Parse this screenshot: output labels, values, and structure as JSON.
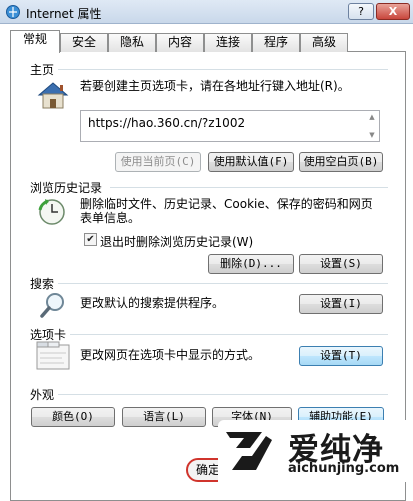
{
  "window": {
    "title": "Internet 属性",
    "help_label": "?",
    "close_label": "X"
  },
  "tabs": [
    {
      "label": "常规",
      "active": true
    },
    {
      "label": "安全"
    },
    {
      "label": "隐私"
    },
    {
      "label": "内容"
    },
    {
      "label": "连接"
    },
    {
      "label": "程序"
    },
    {
      "label": "高级"
    }
  ],
  "homepage": {
    "section_title": "主页",
    "description": "若要创建主页选项卡，请在各地址行键入地址(R)。",
    "url": "https://hao.360.cn/?z1002",
    "use_current_label": "使用当前页(C)",
    "use_default_label": "使用默认值(F)",
    "use_blank_label": "使用空白页(B)"
  },
  "history": {
    "section_title": "浏览历史记录",
    "description_line1": "删除临时文件、历史记录、Cookie、保存的密码和网页",
    "description_line2": "表单信息。",
    "checkbox_label": "退出时删除浏览历史记录(W)",
    "checkbox_checked": true,
    "delete_label": "删除(D)...",
    "settings_label": "设置(S)"
  },
  "search": {
    "section_title": "搜索",
    "description": "更改默认的搜索提供程序。",
    "settings_label": "设置(I)"
  },
  "tabs_section": {
    "section_title": "选项卡",
    "description": "更改网页在选项卡中显示的方式。",
    "settings_label": "设置(T)"
  },
  "appearance": {
    "section_title": "外观",
    "colors_label": "颜色(O)",
    "languages_label": "语言(L)",
    "fonts_label": "字体(N)",
    "accessibility_label": "辅助功能(E)"
  },
  "footer": {
    "ok_label": "确定"
  },
  "watermark": {
    "name": "爱纯净",
    "url": "aichunjing.com"
  },
  "colors": {
    "accent": "#3c7fb1",
    "highlight_ring": "#d0342c"
  }
}
